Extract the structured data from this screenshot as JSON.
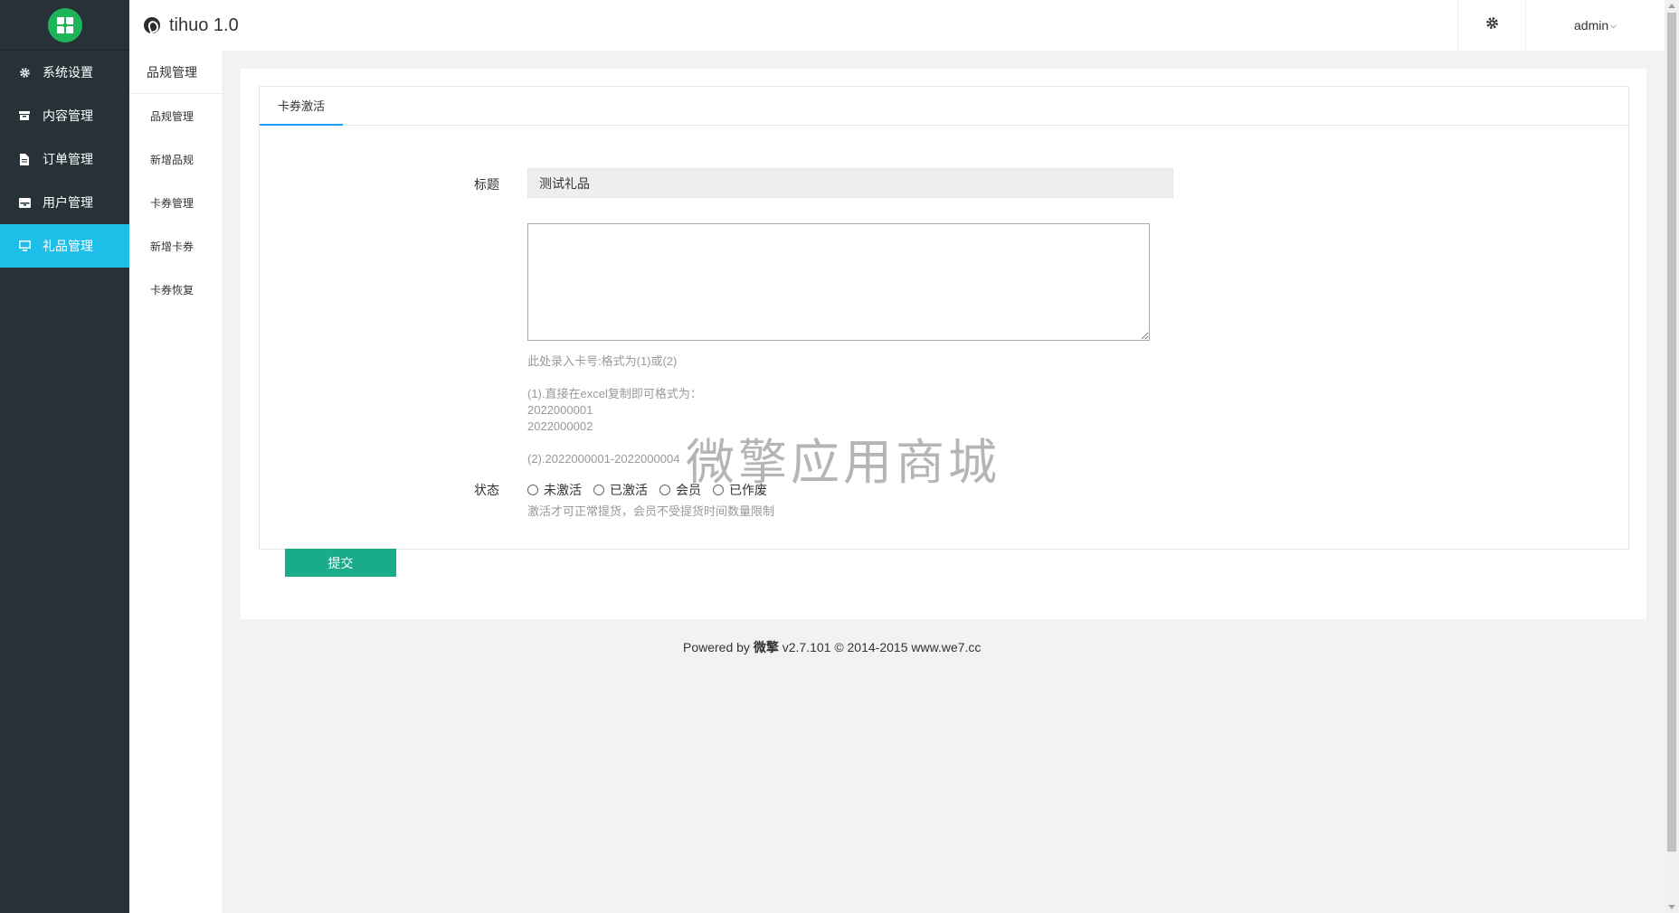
{
  "brand": {
    "title": "tihuo 1.0"
  },
  "header": {
    "user": "admin"
  },
  "sidebar": {
    "items": [
      {
        "label": "系统设置",
        "icon": "gear-icon"
      },
      {
        "label": "内容管理",
        "icon": "archive-icon"
      },
      {
        "label": "订单管理",
        "icon": "file-icon"
      },
      {
        "label": "用户管理",
        "icon": "drawer-icon"
      },
      {
        "label": "礼品管理",
        "icon": "monitor-icon",
        "active": true
      }
    ]
  },
  "subnav": {
    "heading": "品规管理",
    "items": [
      {
        "label": "品规管理"
      },
      {
        "label": "新增品规"
      },
      {
        "label": "卡券管理"
      },
      {
        "label": "新增卡券"
      },
      {
        "label": "卡券恢复"
      }
    ]
  },
  "tabs": [
    {
      "label": "卡券激活"
    }
  ],
  "form": {
    "title_label": "标题",
    "title_value": "测试礼品",
    "cards_value": "",
    "help_lines": [
      "此处录入卡号:格式为(1)或(2)",
      "(1).直接在excel复制即可格式为：",
      "2022000001",
      "2022000002",
      "(2).2022000001-2022000004"
    ],
    "status_label": "状态",
    "status_options": [
      "未激活",
      "已激活",
      "会员",
      "已作废"
    ],
    "status_help": "激活才可正常提货，会员不受提货时间数量限制",
    "submit_label": "提交"
  },
  "footer": {
    "prefix": "Powered by ",
    "brand": "微擎",
    "suffix": " v2.7.101 © 2014-2015 www.we7.cc"
  },
  "watermark": "微擎应用商城",
  "colors": {
    "sidebar_bg": "#263238",
    "active_nav": "#1ebee8",
    "submit": "#1aab8a",
    "tab_underline": "#1e9fff",
    "logo": "#1fb35a"
  }
}
